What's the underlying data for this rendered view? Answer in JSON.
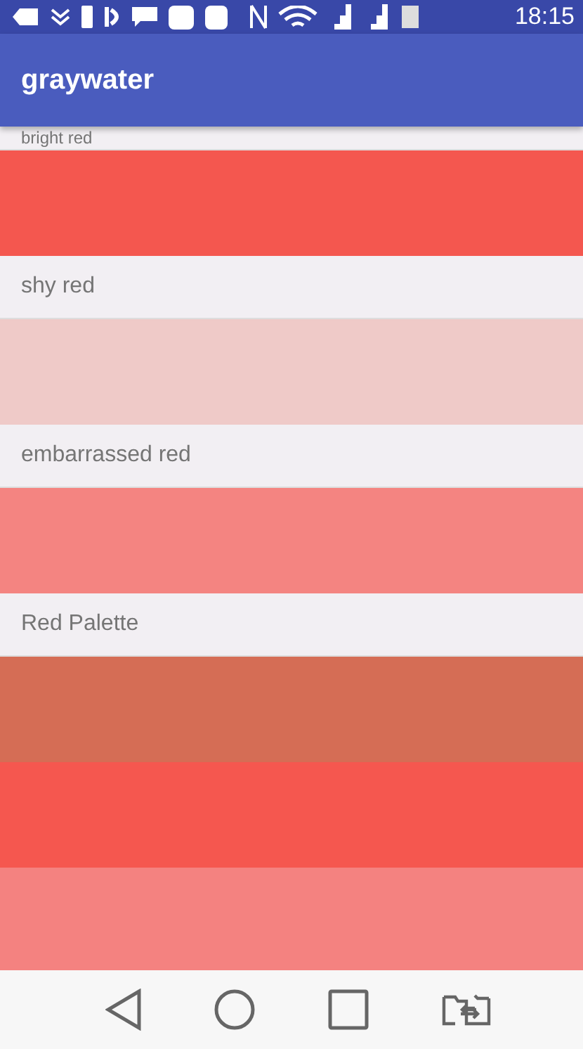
{
  "status_bar": {
    "time": "18:15"
  },
  "app_bar": {
    "title": "graywater"
  },
  "sections": [
    {
      "title": "bright red",
      "swatches": [
        {
          "color": "#f4574f"
        }
      ]
    },
    {
      "title": "shy red",
      "swatches": [
        {
          "color": "#efcac8"
        }
      ]
    },
    {
      "title": "embarrassed red",
      "swatches": [
        {
          "color": "#f48481"
        }
      ]
    },
    {
      "title": "Red Palette",
      "swatches": [
        {
          "color": "#d56d55"
        },
        {
          "color": "#f5574f"
        },
        {
          "color": "#f48280"
        }
      ]
    }
  ]
}
